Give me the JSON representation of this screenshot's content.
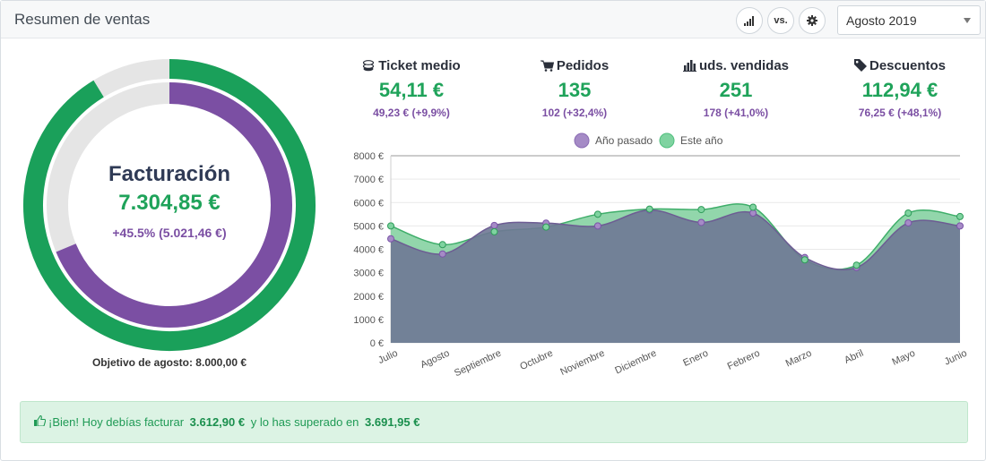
{
  "header": {
    "title": "Resumen de ventas",
    "compare_label": "vs.",
    "period_select": {
      "value": "Agosto 2019"
    }
  },
  "donut": {
    "title": "Facturación",
    "value": "7.304,85 €",
    "change": "+45.5% (5.021,46 €)",
    "caption": "Objetivo de agosto: 8.000,00 €",
    "current_amount": 7304.85,
    "target_amount": 8000,
    "previous_amount": 5021.46,
    "colors": {
      "current": "#1aa05a",
      "previous": "#7b4fa3",
      "track": "#e5e5e5"
    }
  },
  "kpis": [
    {
      "icon": "coins-icon",
      "label": "Ticket medio",
      "value": "54,11 €",
      "previous": "49,23 € (+9,9%)"
    },
    {
      "icon": "cart-icon",
      "label": "Pedidos",
      "value": "135",
      "previous": "102 (+32,4%)"
    },
    {
      "icon": "bar-chart-icon",
      "label": "uds. vendidas",
      "value": "251",
      "previous": "178 (+41,0%)"
    },
    {
      "icon": "tag-icon",
      "label": "Descuentos",
      "value": "112,94 €",
      "previous": "76,25 € (+48,1%)"
    }
  ],
  "chart_data": {
    "type": "area",
    "categories": [
      "Julio",
      "Agosto",
      "Septiembre",
      "Octubre",
      "Noviembre",
      "Diciembre",
      "Enero",
      "Febrero",
      "Marzo",
      "Abril",
      "Mayo",
      "Junio"
    ],
    "series": [
      {
        "name": "Año pasado",
        "color": "#a58bc6",
        "values": [
          4450,
          3800,
          5020,
          5120,
          5000,
          5680,
          5150,
          5550,
          3650,
          3220,
          5130,
          5000
        ]
      },
      {
        "name": "Este año",
        "color": "#7fd3a0",
        "values": [
          5000,
          4200,
          4750,
          4950,
          5500,
          5720,
          5700,
          5800,
          3550,
          3320,
          5550,
          5400
        ]
      }
    ],
    "ylim": [
      0,
      8000
    ],
    "yticks": [
      "0 €",
      "1000 €",
      "2000 €",
      "3000 €",
      "4000 €",
      "5000 €",
      "6000 €",
      "7000 €",
      "8000 €"
    ],
    "legend": "top",
    "grid": true
  },
  "alert": {
    "prefix": "¡Bien! Hoy debías facturar ",
    "target": "3.612,90 €",
    "middle": " y lo has superado en ",
    "surplus": "3.691,95 €"
  }
}
